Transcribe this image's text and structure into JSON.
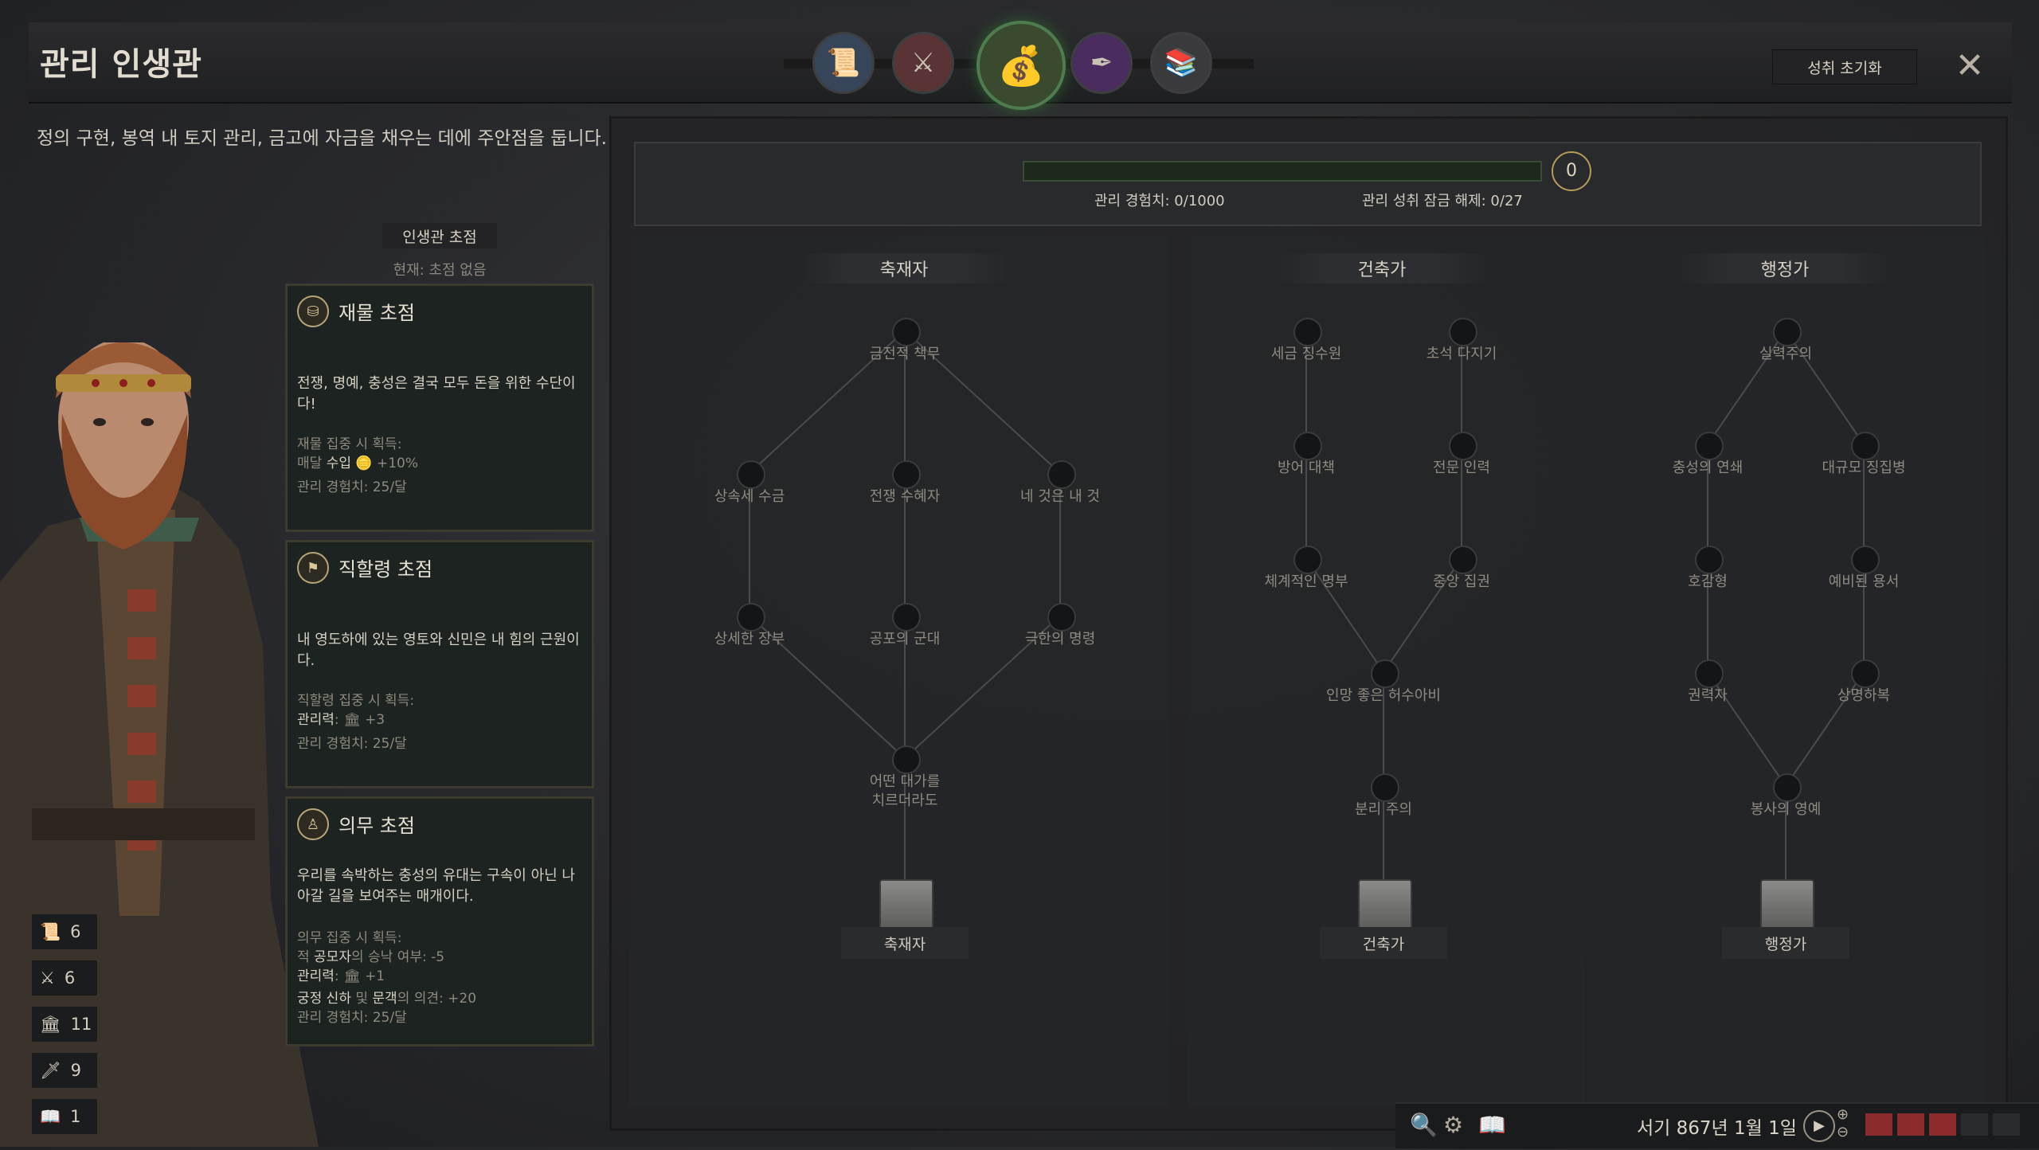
{
  "header": {
    "title": "관리 인생관",
    "reset_label": "성취 초기화",
    "close_glyph": "✕",
    "lifestyles": [
      {
        "name": "scroll-icon",
        "glyph": "📜",
        "active": false
      },
      {
        "name": "helmet-swords-icon",
        "glyph": "⚔",
        "active": false
      },
      {
        "name": "treasure-chest-icon",
        "glyph": "💰",
        "active": true
      },
      {
        "name": "quill-paper-icon",
        "glyph": "✒",
        "active": false
      },
      {
        "name": "books-icon",
        "glyph": "📚",
        "active": false
      }
    ]
  },
  "description": "정의 구현, 봉역 내 토지 관리, 금고에 자금을 채우는 데에 주안점을 둡니다.",
  "focus": {
    "header": "인생관 초점",
    "current": "현재: 초점 없음",
    "cards": [
      {
        "icon": "coin-chest-icon",
        "title": "재물 초점",
        "desc": "전쟁, 명예, 충성은 결국 모두 돈을 위한 수단이다!",
        "gain_label": "재물 집중 시 획득:",
        "effect_prefix": "매달 ",
        "effect_name": "수입",
        "effect_value": "+10%",
        "xp": "관리 경험치: 25/달"
      },
      {
        "icon": "land-icon",
        "title": "직할령 초점",
        "desc": "내 영도하에 있는 영토와 신민은 내 힘의 근원이다.",
        "gain_label": "직할령 집중 시 획득:",
        "effect_name": "관리력",
        "effect_value": "+3",
        "xp": "관리 경험치: 25/달"
      },
      {
        "icon": "duty-icon",
        "title": "의무 초점",
        "desc": "우리를 속박하는 충성의 유대는 구속이 아닌 나아갈 길을 보여주는 매개이다.",
        "gain_label": "의무 집중 시 획득:",
        "effect1_prefix": "적 ",
        "effect1_name": "공모자",
        "effect1_mid": "의 승낙 여부: ",
        "effect1_value": "-5",
        "effect2_name": "관리력",
        "effect2_value": "+1",
        "effect3_a": "궁정 신하",
        "effect3_mid": " 및 ",
        "effect3_b": "문객",
        "effect3_suffix": "의 의견: ",
        "effect3_value": "+20",
        "xp": "관리 경험치: 25/달"
      }
    ]
  },
  "skills": [
    {
      "icon": "diplomacy-icon",
      "glyph": "📜",
      "value": "6"
    },
    {
      "icon": "martial-icon",
      "glyph": "⚔",
      "value": "6"
    },
    {
      "icon": "stewardship-icon",
      "glyph": "🏛",
      "value": "11"
    },
    {
      "icon": "intrigue-icon",
      "glyph": "🗡",
      "value": "9"
    },
    {
      "icon": "learning-icon",
      "glyph": "📖",
      "value": "1"
    }
  ],
  "progress": {
    "xp_label": "관리 경험치: 0/1000",
    "unlock_label": "관리 성취 잠금 해제: 0/27",
    "count": "0",
    "fraction": 0
  },
  "trees": {
    "tree1": {
      "title": "축재자",
      "nodes": [
        "금전적 책무",
        "상속세 수금",
        "전쟁 수혜자",
        "네 것은 내 것",
        "상세한 장부",
        "공포의 군대",
        "극한의 명령",
        "어떤 대가를\n치르더라도"
      ],
      "final": "축재자"
    },
    "tree2": {
      "title": "건축가",
      "nodes": [
        "세금 징수원",
        "초석 다지기",
        "방어 대책",
        "전문 인력",
        "체계적인 명부",
        "중앙 집권",
        "인망 좋은 허수아비",
        "분리 주의"
      ],
      "final": "건축가"
    },
    "tree3": {
      "title": "행정가",
      "nodes": [
        "실력주의",
        "충성의 연쇄",
        "대규모 징집병",
        "호감형",
        "예비된 용서",
        "권력자",
        "상명하복",
        "봉사의 영예"
      ],
      "final": "행정가"
    }
  },
  "bottom": {
    "date": "서기 867년 1월 1일",
    "speed_level": 3
  }
}
